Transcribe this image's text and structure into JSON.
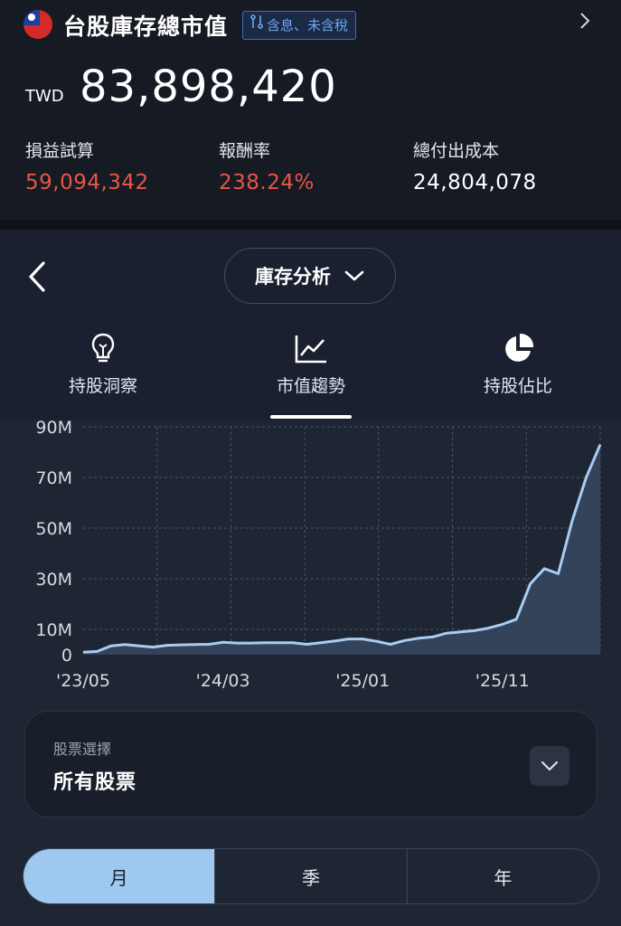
{
  "header": {
    "title": "台股庫存總市值",
    "tax_badge": "含息、未含稅",
    "currency": "TWD",
    "total_value": "83,898,420",
    "stats": [
      {
        "label": "損益試算",
        "value": "59,094,342"
      },
      {
        "label": "報酬率",
        "value": "238.24%"
      },
      {
        "label": "總付出成本",
        "value": "24,804,078"
      }
    ]
  },
  "nav": {
    "dropdown_label": "庫存分析"
  },
  "tabs": [
    {
      "label": "持股洞察",
      "icon": "lightbulb-icon"
    },
    {
      "label": "市值趨勢",
      "icon": "line-chart-icon"
    },
    {
      "label": "持股佔比",
      "icon": "pie-chart-icon"
    }
  ],
  "chart_data": {
    "type": "area",
    "title": "",
    "xlabel": "",
    "ylabel": "",
    "y_unit": "M",
    "ylim": [
      0,
      90
    ],
    "y_ticks": [
      0,
      10,
      30,
      50,
      70,
      90
    ],
    "y_tick_labels": [
      "0",
      "10M",
      "30M",
      "50M",
      "70M",
      "90M"
    ],
    "x_tick_labels": [
      "'23/05",
      "'24/03",
      "'25/01",
      "'25/11"
    ],
    "grid": true,
    "colors": {
      "line": "#a8ccf2",
      "fill": "#34425a"
    },
    "series": [
      {
        "x": [
          "2023-05",
          "2023-06",
          "2023-07",
          "2023-08",
          "2023-09",
          "2023-10",
          "2023-11",
          "2023-12",
          "2024-01",
          "2024-02",
          "2024-03",
          "2024-04",
          "2024-05",
          "2024-06",
          "2024-07",
          "2024-08",
          "2024-09",
          "2024-10",
          "2024-11",
          "2024-12",
          "2025-01",
          "2025-02",
          "2025-03",
          "2025-04",
          "2025-05",
          "2025-06",
          "2025-07",
          "2025-08",
          "2025-09",
          "2025-10",
          "2025-11",
          "2025-12",
          "2026-01",
          "2026-02",
          "2026-03",
          "2026-04",
          "2026-05",
          "2026-06"
        ],
        "values": [
          1,
          1.3,
          3.5,
          4,
          3.5,
          3,
          3.7,
          3.9,
          4,
          4.1,
          4.9,
          4.6,
          4.6,
          4.7,
          4.7,
          4.7,
          4.1,
          4.7,
          5.4,
          6.2,
          6.2,
          5.3,
          4.1,
          5.6,
          6.5,
          7,
          8.5,
          9,
          9.5,
          10.5,
          12,
          14,
          28,
          34,
          32,
          53,
          70,
          83
        ]
      }
    ]
  },
  "stock_select": {
    "caption": "股票選擇",
    "value": "所有股票"
  },
  "period_tabs": [
    "月",
    "季",
    "年"
  ]
}
